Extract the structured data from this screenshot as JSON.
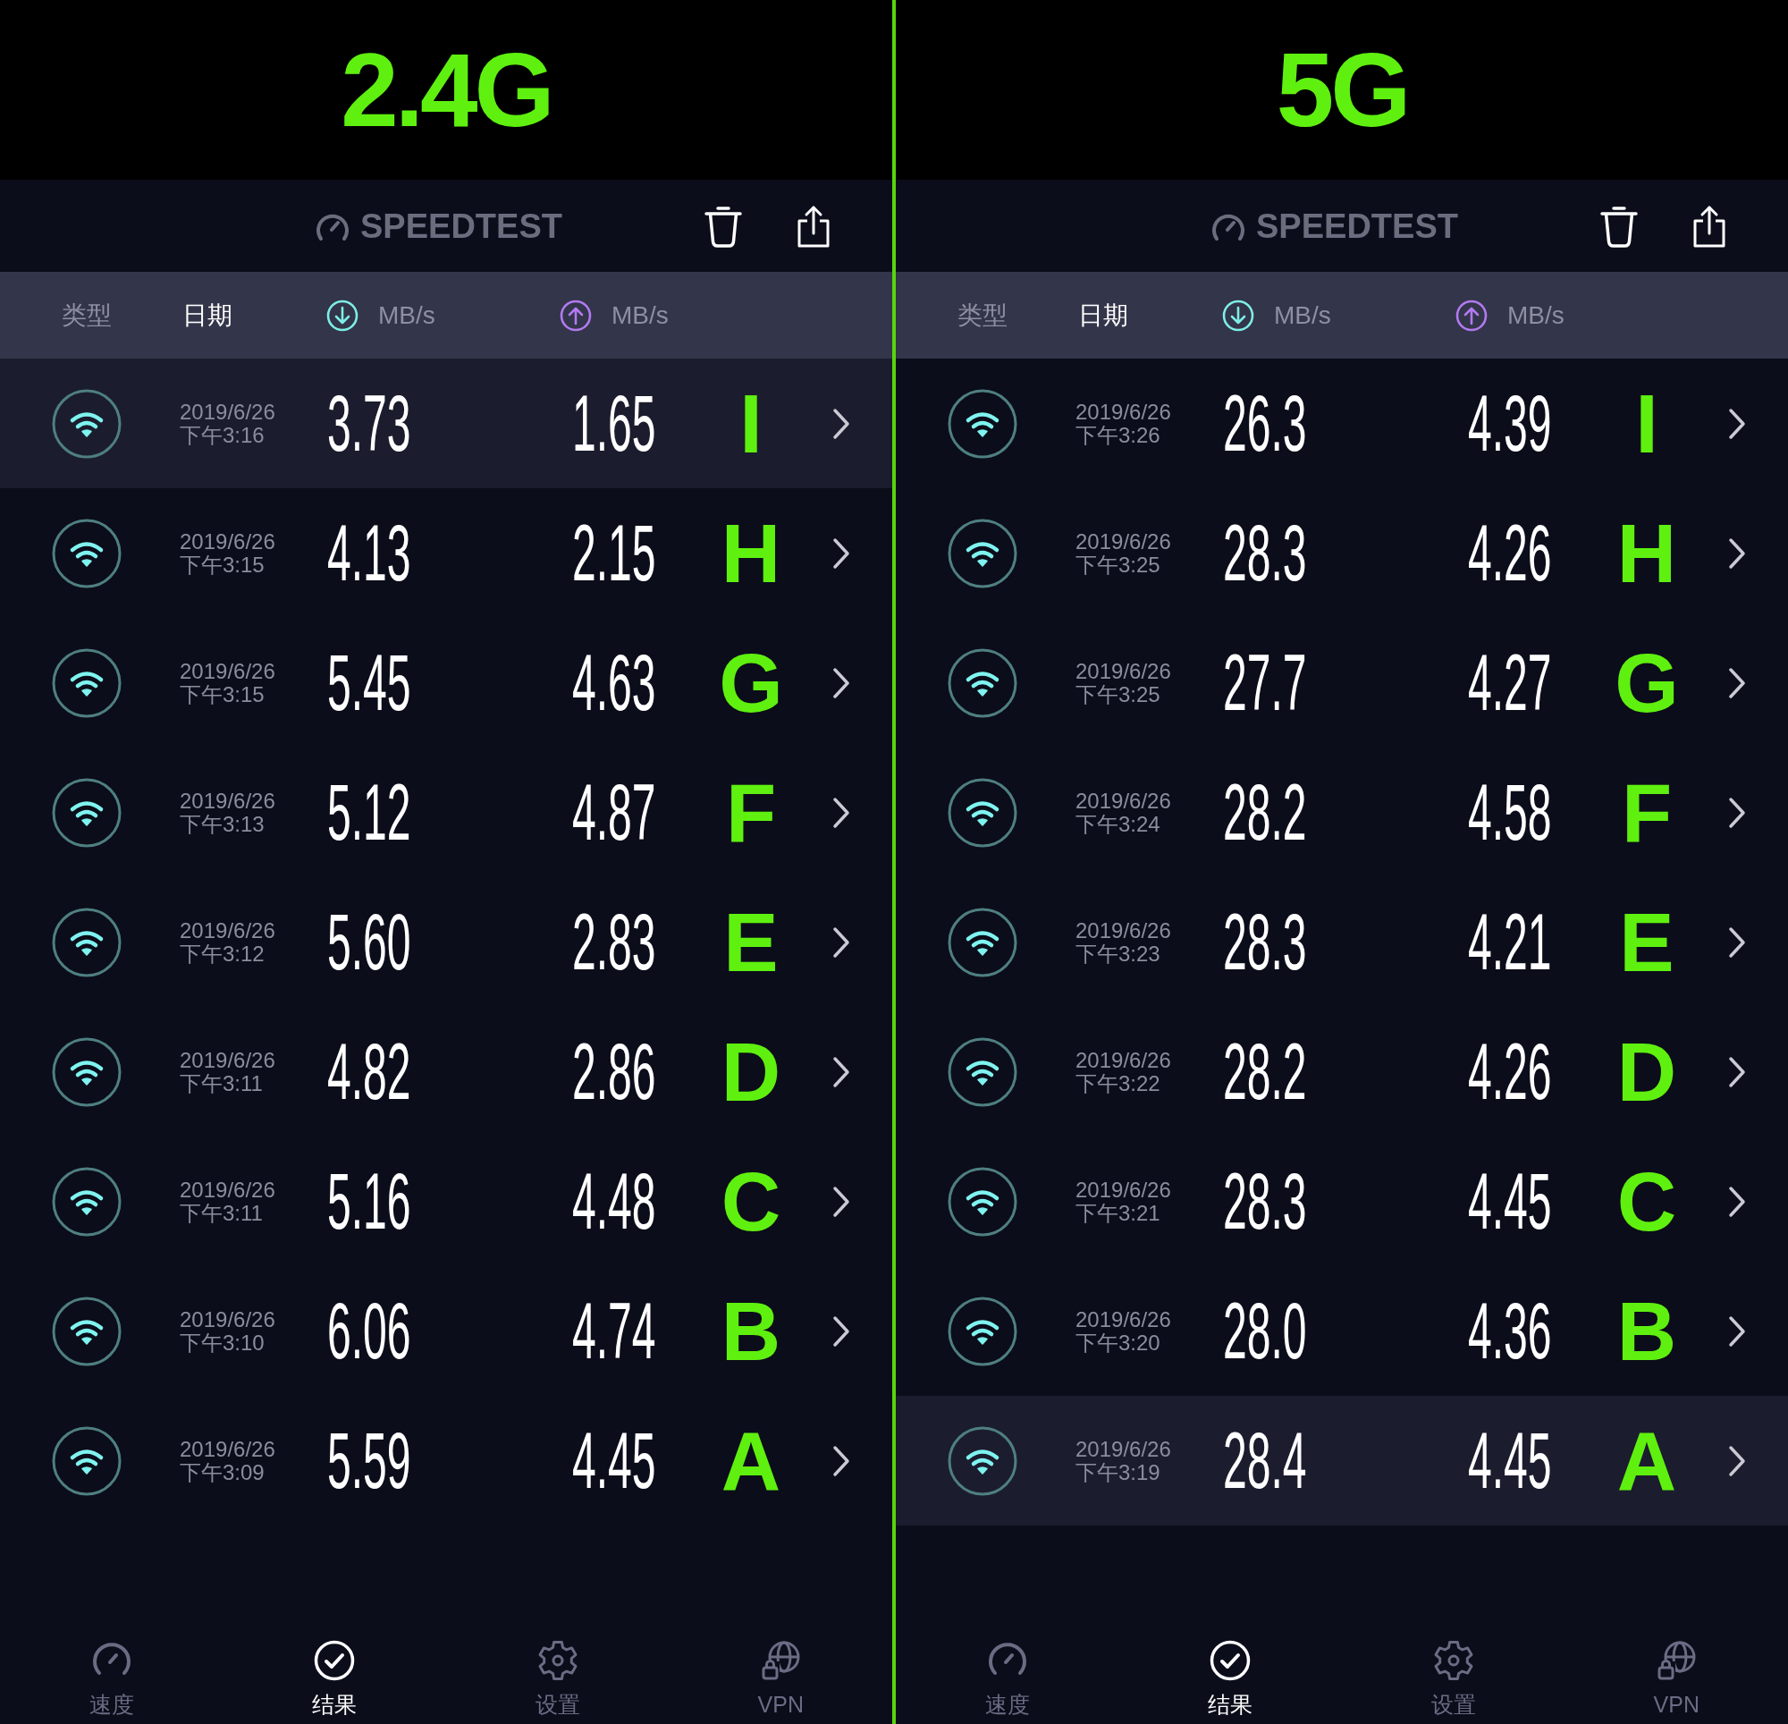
{
  "panels": [
    {
      "title": "2.4G",
      "app_bar": {
        "logo": "SPEEDTEST"
      },
      "columns": [
        {
          "kind": "text",
          "label": "类型",
          "selected": false
        },
        {
          "kind": "text",
          "label": "日期",
          "selected": true
        },
        {
          "kind": "download",
          "label": "MB/s",
          "selected": false
        },
        {
          "kind": "upload",
          "label": "MB/s",
          "selected": false
        }
      ],
      "rows": [
        {
          "date": "2019/6/26",
          "time": "下午3:16",
          "download": "3.73",
          "upload": "1.65",
          "tag": "I",
          "selected": true
        },
        {
          "date": "2019/6/26",
          "time": "下午3:15",
          "download": "4.13",
          "upload": "2.15",
          "tag": "H",
          "selected": false
        },
        {
          "date": "2019/6/26",
          "time": "下午3:15",
          "download": "5.45",
          "upload": "4.63",
          "tag": "G",
          "selected": false
        },
        {
          "date": "2019/6/26",
          "time": "下午3:13",
          "download": "5.12",
          "upload": "4.87",
          "tag": "F",
          "selected": false
        },
        {
          "date": "2019/6/26",
          "time": "下午3:12",
          "download": "5.60",
          "upload": "2.83",
          "tag": "E",
          "selected": false
        },
        {
          "date": "2019/6/26",
          "time": "下午3:11",
          "download": "4.82",
          "upload": "2.86",
          "tag": "D",
          "selected": false
        },
        {
          "date": "2019/6/26",
          "time": "下午3:11",
          "download": "5.16",
          "upload": "4.48",
          "tag": "C",
          "selected": false
        },
        {
          "date": "2019/6/26",
          "time": "下午3:10",
          "download": "6.06",
          "upload": "4.74",
          "tag": "B",
          "selected": false
        },
        {
          "date": "2019/6/26",
          "time": "下午3:09",
          "download": "5.59",
          "upload": "4.45",
          "tag": "A",
          "selected": false
        }
      ],
      "tab_bar": [
        {
          "kind": "speed",
          "label": "速度",
          "selected": false
        },
        {
          "kind": "results",
          "label": "结果",
          "selected": true
        },
        {
          "kind": "settings",
          "label": "设置",
          "selected": false
        },
        {
          "kind": "vpn",
          "label": "VPN",
          "selected": false
        }
      ]
    },
    {
      "title": "5G",
      "app_bar": {
        "logo": "SPEEDTEST"
      },
      "columns": [
        {
          "kind": "text",
          "label": "类型",
          "selected": false
        },
        {
          "kind": "text",
          "label": "日期",
          "selected": true
        },
        {
          "kind": "download",
          "label": "MB/s",
          "selected": false
        },
        {
          "kind": "upload",
          "label": "MB/s",
          "selected": false
        }
      ],
      "rows": [
        {
          "date": "2019/6/26",
          "time": "下午3:26",
          "download": "26.3",
          "upload": "4.39",
          "tag": "I",
          "selected": false
        },
        {
          "date": "2019/6/26",
          "time": "下午3:25",
          "download": "28.3",
          "upload": "4.26",
          "tag": "H",
          "selected": false
        },
        {
          "date": "2019/6/26",
          "time": "下午3:25",
          "download": "27.7",
          "upload": "4.27",
          "tag": "G",
          "selected": false
        },
        {
          "date": "2019/6/26",
          "time": "下午3:24",
          "download": "28.2",
          "upload": "4.58",
          "tag": "F",
          "selected": false
        },
        {
          "date": "2019/6/26",
          "time": "下午3:23",
          "download": "28.3",
          "upload": "4.21",
          "tag": "E",
          "selected": false
        },
        {
          "date": "2019/6/26",
          "time": "下午3:22",
          "download": "28.2",
          "upload": "4.26",
          "tag": "D",
          "selected": false
        },
        {
          "date": "2019/6/26",
          "time": "下午3:21",
          "download": "28.3",
          "upload": "4.45",
          "tag": "C",
          "selected": false
        },
        {
          "date": "2019/6/26",
          "time": "下午3:20",
          "download": "28.0",
          "upload": "4.36",
          "tag": "B",
          "selected": false
        },
        {
          "date": "2019/6/26",
          "time": "下午3:19",
          "download": "28.4",
          "upload": "4.45",
          "tag": "A",
          "selected": true
        }
      ],
      "tab_bar": [
        {
          "kind": "speed",
          "label": "速度",
          "selected": false
        },
        {
          "kind": "results",
          "label": "结果",
          "selected": true
        },
        {
          "kind": "settings",
          "label": "设置",
          "selected": false
        },
        {
          "kind": "vpn",
          "label": "VPN",
          "selected": false
        }
      ]
    }
  ]
}
